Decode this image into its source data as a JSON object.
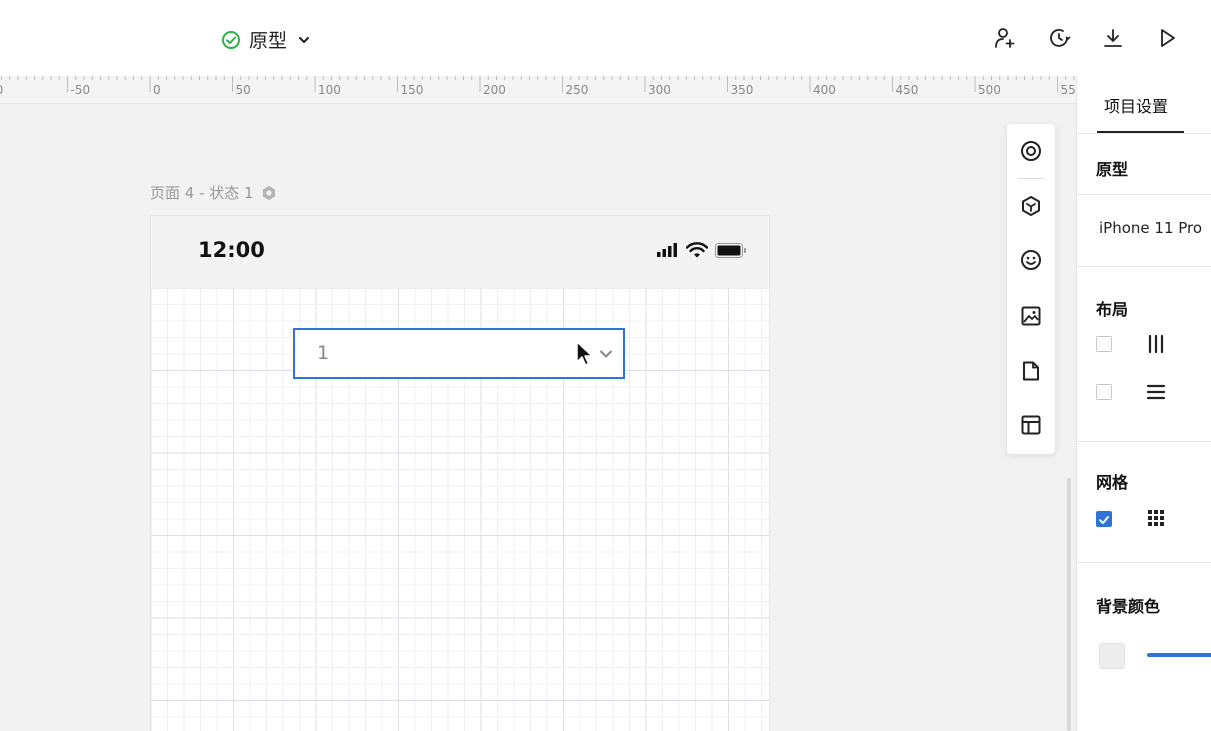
{
  "header": {
    "mode_label": "原型",
    "actions": [
      {
        "name": "add-user-icon"
      },
      {
        "name": "history-icon"
      },
      {
        "name": "download-icon"
      },
      {
        "name": "play-icon"
      }
    ]
  },
  "ruler": {
    "labels": [
      "00",
      "-50",
      "0",
      "50",
      "100",
      "150",
      "200",
      "250",
      "300",
      "350",
      "400",
      "450",
      "500",
      "55"
    ]
  },
  "canvas": {
    "page_label": "页面 4 - 状态 1",
    "status_time": "12:00",
    "select_value": "1"
  },
  "floating_toolbar": {
    "tools": [
      "target-icon",
      "component-icon",
      "emoji-icon",
      "image-icon",
      "page-icon",
      "layout-icon"
    ]
  },
  "panel": {
    "tab": "项目设置",
    "section_prototype": "原型",
    "device": "iPhone 11 Pro",
    "section_layout": "布局",
    "section_grid": "网格",
    "section_bg": "背景颜色",
    "layout_columns_checked": false,
    "layout_rows_checked": false,
    "grid_checked": true
  },
  "colors": {
    "accent": "#2e74d6",
    "success": "#2bb24c"
  }
}
